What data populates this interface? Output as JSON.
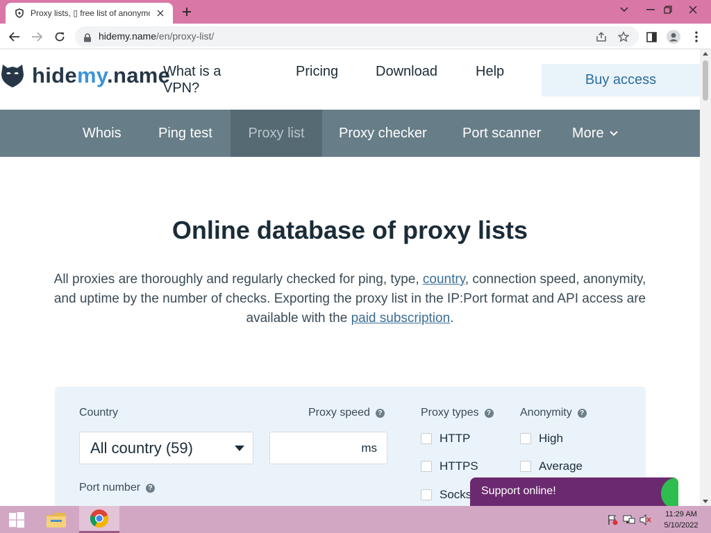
{
  "browser": {
    "tab_title": "Proxy lists, ▯ free list of anonymo",
    "url_host": "hidemy.name",
    "url_path": "/en/proxy-list/",
    "colors": {
      "titlebar": "#d977a6",
      "taskbar": "#d2a7c4"
    }
  },
  "site": {
    "logo": {
      "part1": "hide",
      "part2": "my",
      "part3": ".name"
    },
    "nav": [
      {
        "label": "What is a VPN?"
      },
      {
        "label": "Pricing"
      },
      {
        "label": "Download"
      },
      {
        "label": "Help"
      }
    ],
    "buy_access": "Buy access",
    "subnav": [
      {
        "label": "Whois",
        "active": false
      },
      {
        "label": "Ping test",
        "active": false
      },
      {
        "label": "Proxy list",
        "active": true
      },
      {
        "label": "Proxy checker",
        "active": false
      },
      {
        "label": "Port scanner",
        "active": false
      },
      {
        "label": "More",
        "active": false
      }
    ],
    "colors": {
      "subnav_bg": "#677d87",
      "subnav_active": "#566a73",
      "accent": "#3d94d6",
      "support_bg": "#6b2a6f"
    }
  },
  "hero": {
    "title": "Online database of proxy lists",
    "desc_1": "All proxies are thoroughly and regularly checked for ping, type, ",
    "link_country": "country",
    "desc_2": ", connection speed, anonymity, and uptime by the number of checks. Exporting the proxy list in the IP:Port format and API access are available with the ",
    "link_paid": "paid subscription",
    "desc_3": "."
  },
  "filters": {
    "country_label": "Country",
    "country_value": "All country (59)",
    "speed_label": "Proxy speed",
    "speed_value": "",
    "speed_unit": "ms",
    "port_label": "Port number",
    "types_label": "Proxy types",
    "types": [
      "HTTP",
      "HTTPS",
      "Socks"
    ],
    "anonymity_label": "Anonymity",
    "anonymity": [
      "High",
      "Average"
    ]
  },
  "support": {
    "label": "Support online!"
  },
  "taskbar": {
    "time": "11:29 AM",
    "date": "5/10/2022"
  }
}
